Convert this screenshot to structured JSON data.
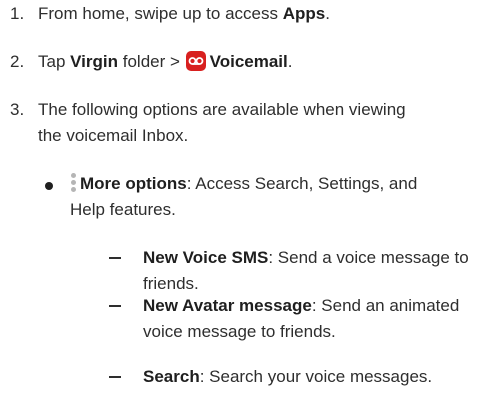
{
  "steps": [
    {
      "num": "1.",
      "pre": "From home, swipe up to access ",
      "bold": "Apps",
      "post": "."
    },
    {
      "num": "2.",
      "pre": "Tap ",
      "bold1": "Virgin",
      "mid": " folder > ",
      "bold2": "Voicemail",
      "post": "."
    },
    {
      "num": "3.",
      "line1": "The following options are available when viewing",
      "line2": "the voicemail Inbox."
    }
  ],
  "bullet": {
    "bold": "More options",
    "line1_rest": ": Access Search, Settings, and",
    "line2": "Help features."
  },
  "subitems": [
    {
      "bold": "New Voice SMS",
      "line1_rest": ": Send a voice message to",
      "line2": "friends."
    },
    {
      "bold": "New Avatar message",
      "line1_rest": ": Send an animated",
      "line2": "voice message to friends."
    },
    {
      "bold": "Search",
      "line1_rest": ": Search your voice messages.",
      "line2": ""
    }
  ],
  "icons": {
    "voicemail_icon": "voicemail-app-icon",
    "more_icon": "vertical-dots-icon"
  },
  "colors": {
    "voicemail_icon_bg": "#d8201f",
    "text": "#2e2e2e"
  }
}
